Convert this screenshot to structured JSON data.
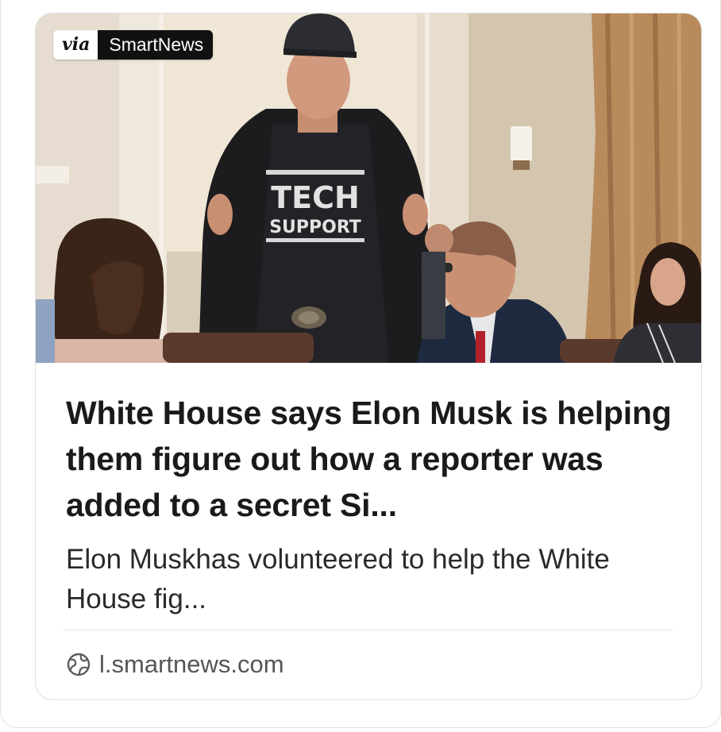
{
  "card": {
    "source_badge": {
      "prefix": "via",
      "brand": "SmartNews"
    },
    "image": {
      "shirt_text_line1": "TECH",
      "shirt_text_line2": "SUPPORT"
    },
    "headline": "White House says Elon Musk is helping them figure out how a reporter was added to a secret Si...",
    "summary": "Elon Muskhas volunteered to help the White House fig...",
    "source": {
      "icon": "globe-icon",
      "domain": "l.smartnews.com"
    }
  },
  "colors": {
    "headline": "#1a1a1a",
    "summary": "#2a2a2a",
    "domain": "#555555",
    "card_border": "#dedede",
    "badge_dark": "#111111"
  }
}
